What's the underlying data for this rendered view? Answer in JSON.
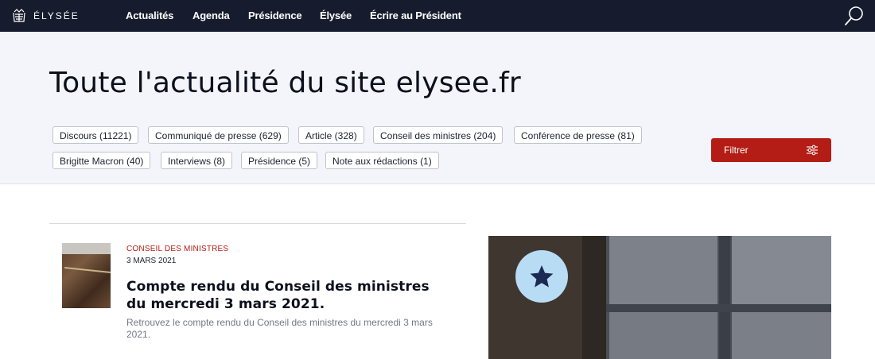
{
  "nav": {
    "logo_text": "ÉLYSÉE",
    "items": [
      {
        "label": "Actualités"
      },
      {
        "label": "Agenda"
      },
      {
        "label": "Présidence"
      },
      {
        "label": "Élysée"
      },
      {
        "label": "Écrire au Président"
      }
    ]
  },
  "hero": {
    "title": "Toute l'actualité du site elysee.fr",
    "filters": [
      {
        "label": "Discours (11221)"
      },
      {
        "label": "Communiqué de presse (629)"
      },
      {
        "label": "Article (328)"
      },
      {
        "label": "Conseil des ministres (204)"
      },
      {
        "label": "Conférence de presse (81)"
      },
      {
        "label": "Brigitte Macron (40)"
      },
      {
        "label": "Interviews (8)"
      },
      {
        "label": "Présidence (5)"
      },
      {
        "label": "Note aux rédactions (1)"
      }
    ],
    "filter_button": "Filtrer"
  },
  "article": {
    "category": "CONSEIL DES MINISTRES",
    "date": "3 MARS 2021",
    "title": "Compte rendu du Conseil des ministres du mercredi 3 mars 2021.",
    "description": "Retrouvez le compte rendu du Conseil des ministres du mercredi 3 mars 2021."
  },
  "colors": {
    "nav_bg": "#161b2e",
    "hero_bg": "#f3f5fa",
    "accent_red": "#b41d15",
    "badge_blue": "#b8dcf4",
    "star_navy": "#1b2a52"
  },
  "icons": {
    "logo": "elysee-emblem-icon",
    "search": "search-icon",
    "filter": "sliders-icon",
    "badge": "star-icon"
  }
}
